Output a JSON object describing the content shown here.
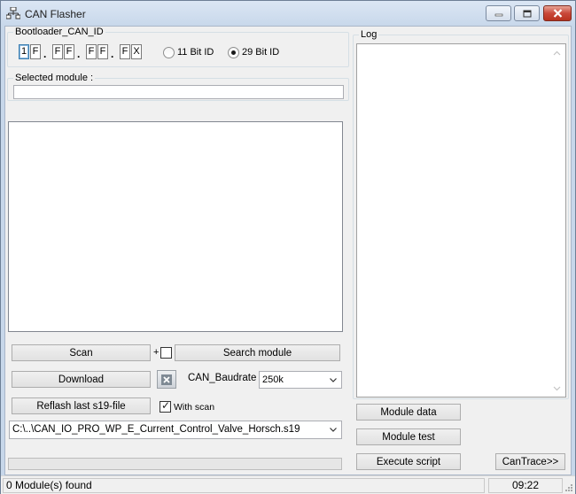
{
  "window": {
    "title": "CAN Flasher",
    "icons": {
      "app": "network-icon",
      "minimize": "minimize-icon",
      "maximize": "maximize-icon",
      "close": "close-icon"
    }
  },
  "bootloader": {
    "label": "Bootloader_CAN_ID",
    "digits": [
      "1",
      "F",
      "F",
      "F",
      "F",
      "F",
      "F",
      "X"
    ],
    "separator": ".",
    "radio_11": "11 Bit ID",
    "radio_29": "29 Bit ID",
    "selected_id_mode": "29 Bit ID"
  },
  "selected_module": {
    "label": "Selected module :",
    "value": ""
  },
  "controls": {
    "scan_label": "Scan",
    "plus_label": "+",
    "search_label": "Search module",
    "download_label": "Download",
    "baudrate_label": "CAN_Baudrate :",
    "baudrate_value": "250k",
    "reflash_label": "Reflash last s19-file",
    "with_scan_label": "With scan",
    "with_scan_checked": true,
    "file_path": "C:\\..\\CAN_IO_PRO_WP_E_Current_Control_Valve_Horsch.s19"
  },
  "log": {
    "label": "Log",
    "module_data_label": "Module data",
    "module_test_label": "Module test",
    "execute_script_label": "Execute script",
    "can_trace_label": "CanTrace>>"
  },
  "status": {
    "modules_found": "0 Module(s) found",
    "time": "09:22"
  },
  "colors": {
    "close_button": "#c9483a",
    "client_bg": "#f0f0f0",
    "title_gradient": "#dbe6f4"
  }
}
